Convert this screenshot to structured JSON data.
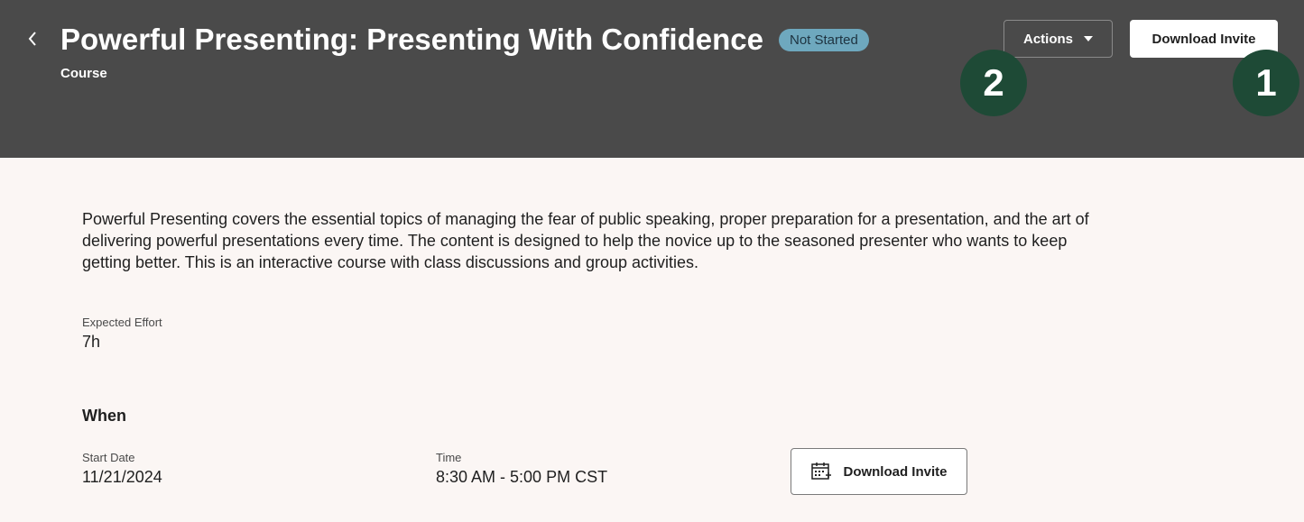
{
  "header": {
    "title": "Powerful Presenting: Presenting With Confidence",
    "status_badge": "Not Started",
    "subtitle": "Course",
    "actions_label": "Actions",
    "download_label": "Download Invite",
    "callouts": [
      "2",
      "1"
    ]
  },
  "main": {
    "description": "Powerful Presenting covers the essential topics of managing the fear of public speaking, proper preparation for a presentation, and the art of delivering powerful presentations every time.  The content is designed to help the novice up to the seasoned presenter who wants to keep getting better. This is an interactive course with class discussions and group activities.",
    "effort": {
      "label": "Expected Effort",
      "value": "7h"
    },
    "when": {
      "heading": "When",
      "start_date": {
        "label": "Start Date",
        "value": "11/21/2024"
      },
      "time": {
        "label": "Time",
        "value": "8:30 AM - 5:00 PM CST"
      },
      "download_label": "Download Invite"
    }
  },
  "colors": {
    "header_bg": "#4a4a4a",
    "page_bg": "#fbf6f4",
    "badge_bg": "#6ea8be",
    "callout_bg": "#1e4a36"
  }
}
